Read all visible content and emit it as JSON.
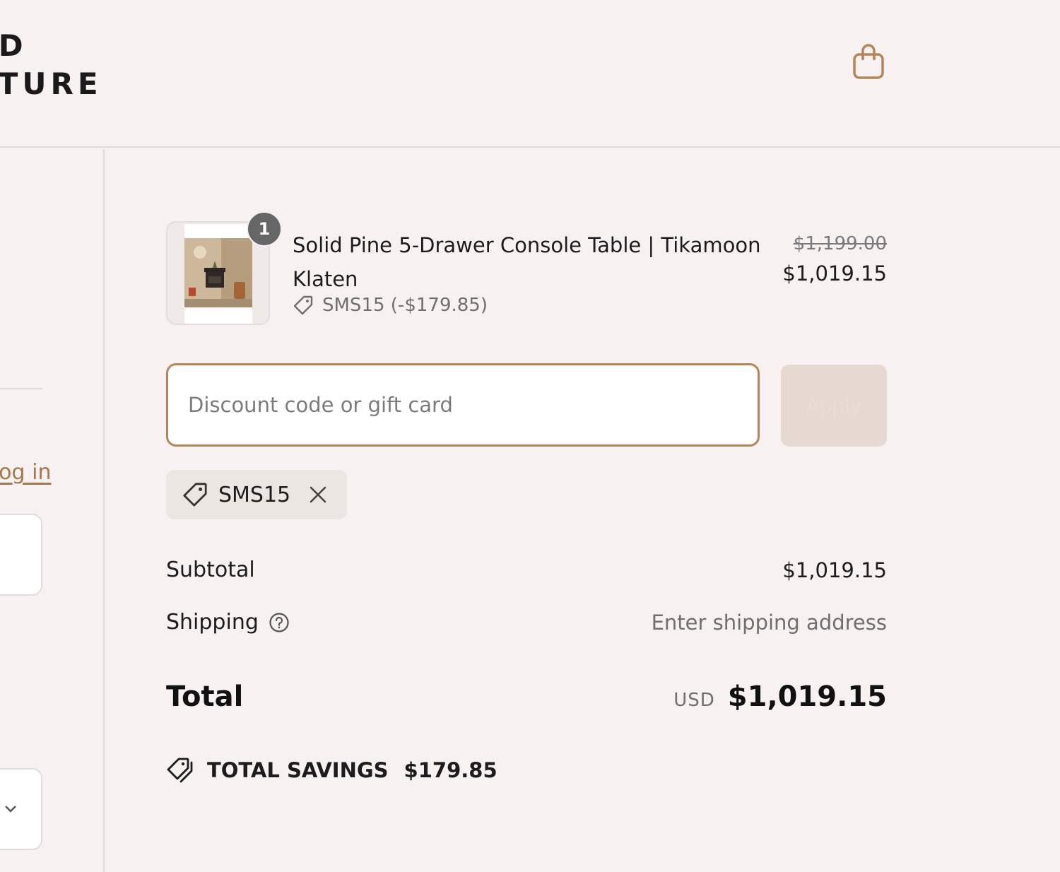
{
  "header": {
    "logo_line1": "OD",
    "logo_line2": "NITURE",
    "cart_icon": "shopping-bag-icon"
  },
  "left_panel": {
    "login_link": "Log in",
    "select_icon": "chevron-down-icon"
  },
  "product": {
    "quantity": "1",
    "name": "Solid Pine 5-Drawer Console Table | Tikamoon Klaten",
    "discount_code": "SMS15 (-$179.85)",
    "price_original": "$1,199.00",
    "price_current": "$1,019.15"
  },
  "discount": {
    "placeholder": "Discount code or gift card",
    "apply_label": "Apply",
    "applied_code": "SMS15"
  },
  "totals": {
    "subtotal_label": "Subtotal",
    "subtotal_value": "$1,019.15",
    "shipping_label": "Shipping",
    "shipping_value": "Enter shipping address",
    "total_label": "Total",
    "currency": "USD",
    "total_value": "$1,019.15",
    "savings_label": "TOTAL SAVINGS",
    "savings_value": "$179.85"
  },
  "colors": {
    "background": "#f7f2f1",
    "accent": "#b38659",
    "apply_disabled": "#e6d9d1",
    "badge": "#666666"
  }
}
